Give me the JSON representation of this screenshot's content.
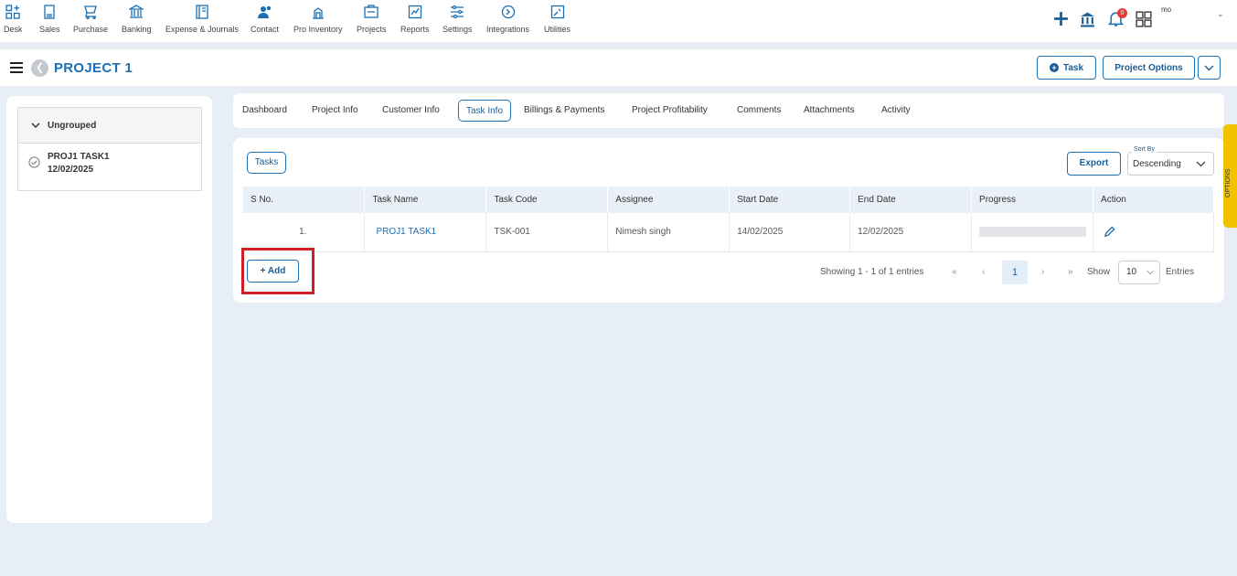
{
  "nav": {
    "items": [
      {
        "label": "Desk",
        "icon": "desk-icon"
      },
      {
        "label": "Sales",
        "icon": "sales-icon"
      },
      {
        "label": "Purchase",
        "icon": "purchase-icon"
      },
      {
        "label": "Banking",
        "icon": "bank-icon"
      },
      {
        "label": "Expense & Journals",
        "icon": "journal-icon"
      },
      {
        "label": "Contact",
        "icon": "contact-icon"
      },
      {
        "label": "Pro Inventory",
        "icon": "inventory-icon"
      },
      {
        "label": "Projects",
        "icon": "projects-icon"
      },
      {
        "label": "Reports",
        "icon": "reports-icon"
      },
      {
        "label": "Settings",
        "icon": "settings-icon"
      },
      {
        "label": "Integrations",
        "icon": "integrations-icon"
      },
      {
        "label": "Utilities",
        "icon": "utilities-icon"
      }
    ],
    "notification_count": "0",
    "user": "mo",
    "accent": "#1a6fb5"
  },
  "header": {
    "title": "PROJECT 1",
    "task_button": "Task",
    "project_options_button": "Project Options"
  },
  "sidebar": {
    "group_label": "Ungrouped",
    "items": [
      {
        "name": "PROJ1 TASK1",
        "date": "12/02/2025"
      }
    ]
  },
  "tabs": [
    {
      "label": "Dashboard"
    },
    {
      "label": "Project Info"
    },
    {
      "label": "Customer Info"
    },
    {
      "label": "Task Info",
      "active": true
    },
    {
      "label": "Billings & Payments"
    },
    {
      "label": "Project Profitability"
    },
    {
      "label": "Comments"
    },
    {
      "label": "Attachments"
    },
    {
      "label": "Activity"
    }
  ],
  "main": {
    "tasks_label": "Tasks",
    "export_label": "Export",
    "sort_by_label": "Sort By",
    "sort_value": "Descending",
    "columns": [
      "S No.",
      "Task Name",
      "Task Code",
      "Assignee",
      "Start Date",
      "End Date",
      "Progress",
      "Action"
    ],
    "rows": [
      {
        "sno": "1.",
        "task_name": "PROJ1 TASK1",
        "task_code": "TSK-001",
        "assignee": "Nimesh singh",
        "start_date": "14/02/2025",
        "end_date": "12/02/2025",
        "progress": 0
      }
    ],
    "add_label": "+ Add",
    "showing_text": "Showing 1 - 1 of 1 entries",
    "current_page": "1",
    "show_label": "Show",
    "page_size": "10",
    "entries_label": "Entries"
  },
  "options_tab_label": "OPTIONS"
}
